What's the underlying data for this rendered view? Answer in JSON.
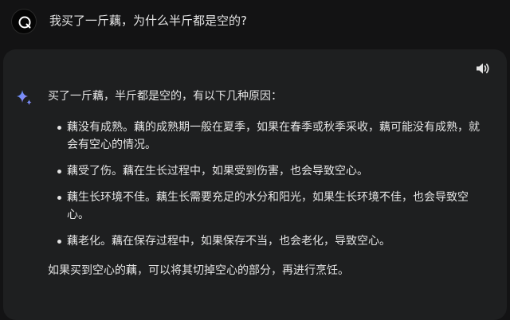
{
  "user_message": {
    "text": "我买了一斤藕，为什么半斤都是空的?",
    "avatar_icon": "q-logo-icon"
  },
  "response": {
    "toolbar": {
      "speaker_icon": "speaker-icon"
    },
    "assistant_icon": "sparkle-icon",
    "intro": "买了一斤藕，半斤都是空的，有以下几种原因：",
    "points": [
      {
        "text": "藕没有成熟。藕的成熟期一般在夏季，如果在春季或秋季采收，藕可能没有成熟，就会有空心的情况。"
      },
      {
        "text": "藕受了伤。藕在生长过程中，如果受到伤害，也会导致空心。"
      },
      {
        "text": "藕生长环境不佳。藕生长需要充足的水分和阳光，如果生长环境不佳，也会导致空心。"
      },
      {
        "text": "藕老化。藕在保存过程中，如果保存不当，也会老化，导致空心。"
      }
    ],
    "conclusion": "如果买到空心的藕，可以将其切掉空心的部分，再进行烹饪。"
  },
  "colors": {
    "background": "#131314",
    "card": "#1e1f20",
    "text": "#e3e3e3",
    "sparkle_start": "#4f8ff7",
    "sparkle_end": "#a78bfa"
  }
}
